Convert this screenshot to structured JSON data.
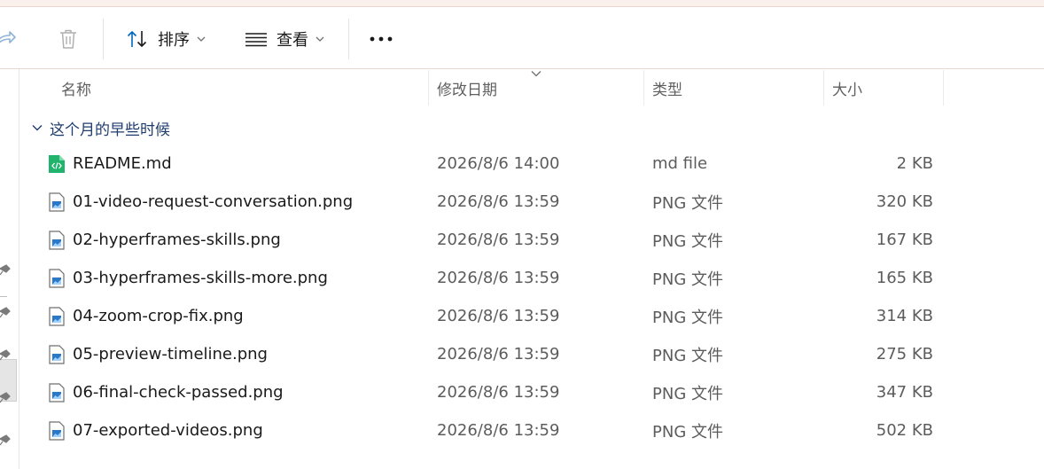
{
  "toolbar": {
    "sort_label": "排序",
    "view_label": "查看"
  },
  "columns": {
    "name": "名称",
    "date": "修改日期",
    "type": "类型",
    "size": "大小"
  },
  "group": {
    "label": "这个月的早些时候"
  },
  "files": [
    {
      "name": "README.md",
      "date": "2026/8/6 14:00",
      "type": "md file",
      "size": "2 KB",
      "icon": "markdown-file-icon"
    },
    {
      "name": "01-video-request-conversation.png",
      "date": "2026/8/6 13:59",
      "type": "PNG 文件",
      "size": "320 KB",
      "icon": "png-file-icon"
    },
    {
      "name": "02-hyperframes-skills.png",
      "date": "2026/8/6 13:59",
      "type": "PNG 文件",
      "size": "167 KB",
      "icon": "png-file-icon"
    },
    {
      "name": "03-hyperframes-skills-more.png",
      "date": "2026/8/6 13:59",
      "type": "PNG 文件",
      "size": "165 KB",
      "icon": "png-file-icon"
    },
    {
      "name": "04-zoom-crop-fix.png",
      "date": "2026/8/6 13:59",
      "type": "PNG 文件",
      "size": "314 KB",
      "icon": "png-file-icon"
    },
    {
      "name": "05-preview-timeline.png",
      "date": "2026/8/6 13:59",
      "type": "PNG 文件",
      "size": "275 KB",
      "icon": "png-file-icon"
    },
    {
      "name": "06-final-check-passed.png",
      "date": "2026/8/6 13:59",
      "type": "PNG 文件",
      "size": "347 KB",
      "icon": "png-file-icon"
    },
    {
      "name": "07-exported-videos.png",
      "date": "2026/8/6 13:59",
      "type": "PNG 文件",
      "size": "502 KB",
      "icon": "png-file-icon"
    }
  ],
  "colors": {
    "accent": "#0067c0",
    "markdown_icon": "#1fb36b",
    "group_text": "#1f3c6e"
  }
}
